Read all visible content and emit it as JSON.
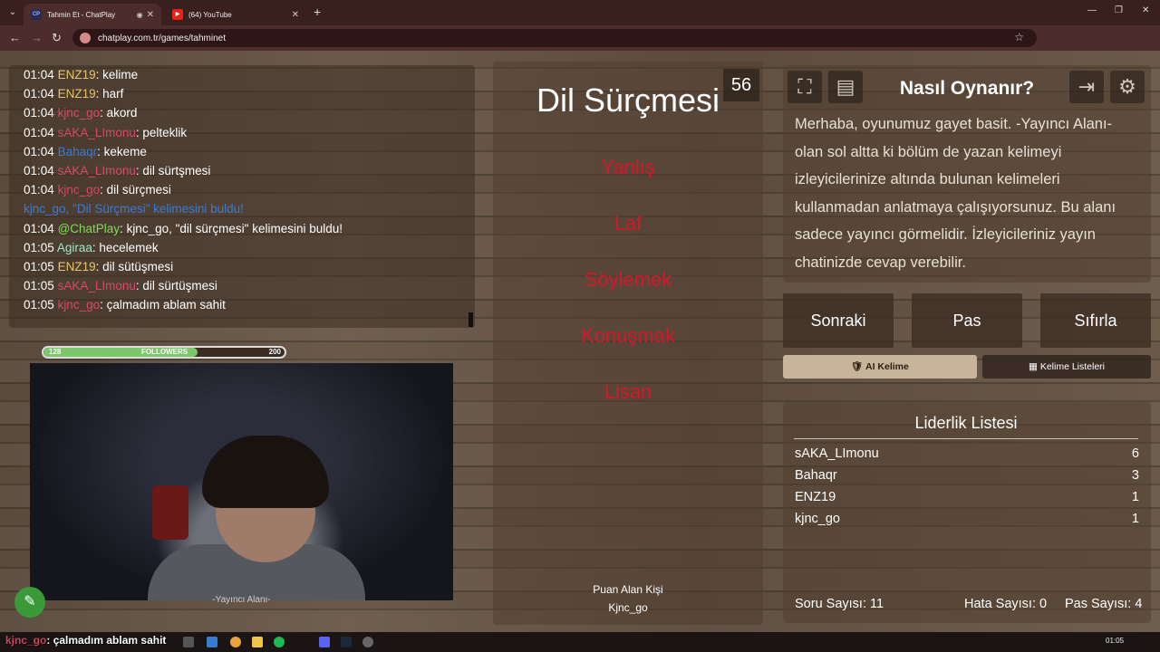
{
  "browser": {
    "tabs": [
      {
        "title": "Tahmin Et - ChatPlay",
        "favicon": "CP",
        "active": true
      },
      {
        "title": "(64) YouTube",
        "favicon": "youtube-icon",
        "active": false
      }
    ],
    "url": "chatplay.com.tr/games/tahminet"
  },
  "chat": [
    {
      "time": "01:04",
      "user": "ENZ19",
      "color": "#e9c46a",
      "msg": "kelime"
    },
    {
      "time": "01:04",
      "user": "ENZ19",
      "color": "#e9c46a",
      "msg": "harf"
    },
    {
      "time": "01:04",
      "user": "kjnc_go",
      "color": "#d9476a",
      "msg": "akord"
    },
    {
      "time": "01:04",
      "user": "sAKA_LImonu",
      "color": "#d9476a",
      "msg": "pelteklik"
    },
    {
      "time": "01:04",
      "user": "Bahaqr",
      "color": "#3a7bd5",
      "msg": "kekeme"
    },
    {
      "time": "01:04",
      "user": "sAKA_LImonu",
      "color": "#d9476a",
      "msg": "dil sürtşmesi"
    },
    {
      "time": "01:04",
      "user": "kjnc_go",
      "color": "#d9476a",
      "msg": "dil sürçmesi"
    },
    {
      "time": "",
      "user": "",
      "color": "#3a7bd5",
      "msg": "kjnc_go, \"Dil Sürçmesi\" kelimesini buldu!"
    },
    {
      "time": "01:04",
      "user": "@ChatPlay",
      "color": "#7ddc5a",
      "msg": "kjnc_go, \"dil sürçmesi\" kelimesini buldu!"
    },
    {
      "time": "01:05",
      "user": "Agiraa",
      "color": "#9ee6c8",
      "msg": "hecelemek"
    },
    {
      "time": "01:05",
      "user": "ENZ19",
      "color": "#e9c46a",
      "msg": "dil sütüşmesi"
    },
    {
      "time": "01:05",
      "user": "sAKA_LImonu",
      "color": "#d9476a",
      "msg": "dil sürtüşmesi"
    },
    {
      "time": "01:05",
      "user": "kjnc_go",
      "color": "#d9476a",
      "msg": "çalmadım ablam sahit"
    }
  ],
  "followers": {
    "label": "FOLLOWERS",
    "current": "128",
    "goal": "200",
    "progress": 0.64
  },
  "stream": {
    "label": "-Yayıncı Alanı-"
  },
  "game": {
    "word": "Dil Sürçmesi",
    "counter": "56",
    "forbidden": [
      "Yanlış",
      "Laf",
      "Söylemek",
      "Konuşmak",
      "Lisan"
    ],
    "scorer_label": "Puan Alan Kişi",
    "scorer_name": "Kjnc_go"
  },
  "how_to": {
    "title": "Nasıl Oynanır?",
    "text": "Merhaba, oyunumuz gayet basit. -Yayıncı Alanı- olan sol altta ki bölüm de yazan kelimeyi izleyicilerinize altında bulunan kelimeleri kullanmadan anlatmaya çalışıyorsunuz. Bu alanı sadece yayıncı görmelidir. İzleyicileriniz yayın chatinizde cevap verebilir."
  },
  "controls": {
    "next": "Sonraki",
    "pass": "Pas",
    "reset": "Sıfırla"
  },
  "tabs": {
    "ai": "AI Kelime",
    "lists": "Kelime Listeleri"
  },
  "leaderboard": {
    "title": "Liderlik Listesi",
    "rows": [
      {
        "name": "sAKA_LImonu",
        "score": "6"
      },
      {
        "name": "Bahaqr",
        "score": "3"
      },
      {
        "name": "ENZ19",
        "score": "1"
      },
      {
        "name": "kjnc_go",
        "score": "1"
      }
    ]
  },
  "stats": {
    "questions": "Soru Sayısı: 11",
    "mistakes": "Hata Sayısı: 0",
    "passes": "Pas Sayısı: 4"
  },
  "taskbar": {
    "ticker_user": "kjnc_go",
    "ticker_msg": ": çalmadım ablam sahit",
    "clock": "01:05"
  }
}
